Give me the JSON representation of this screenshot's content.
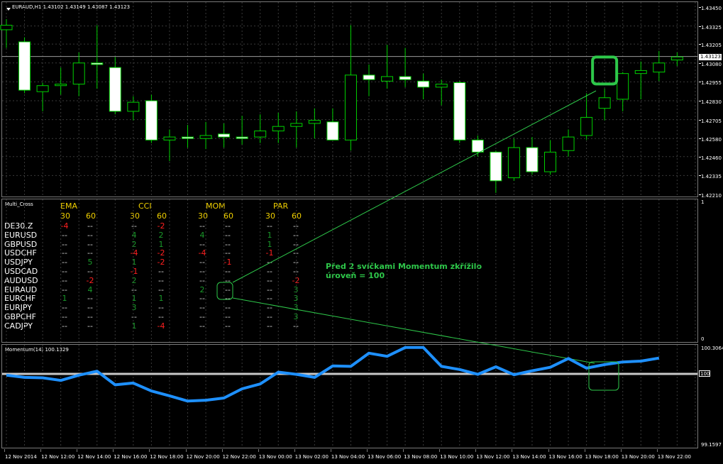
{
  "chart_data": [
    {
      "type": "candlestick",
      "title": "EURAUD,H1  1.43102 1.43149 1.43087 1.43123",
      "symbol": "EURAUD",
      "timeframe": "H1",
      "ohlc_header": "1.43102 1.43149 1.43087 1.43123",
      "current_price": "1.43123",
      "y_ticks": [
        "1.43450",
        "1.43325",
        "1.43205",
        "1.43080",
        "1.42955",
        "1.42830",
        "1.42705",
        "1.42580",
        "1.42460",
        "1.42335",
        "1.42210"
      ],
      "ylim": [
        1.4221,
        1.4345
      ],
      "candles": [
        {
          "o": 1.433,
          "h": 1.4337,
          "l": 1.4318,
          "c": 1.4333
        },
        {
          "o": 1.4322,
          "h": 1.4325,
          "l": 1.4288,
          "c": 1.429
        },
        {
          "o": 1.4289,
          "h": 1.4295,
          "l": 1.4276,
          "c": 1.4293
        },
        {
          "o": 1.4293,
          "h": 1.4305,
          "l": 1.4287,
          "c": 1.4294
        },
        {
          "o": 1.4294,
          "h": 1.4315,
          "l": 1.4286,
          "c": 1.4308
        },
        {
          "o": 1.4308,
          "h": 1.4333,
          "l": 1.4291,
          "c": 1.4307
        },
        {
          "o": 1.4305,
          "h": 1.4312,
          "l": 1.4274,
          "c": 1.4276
        },
        {
          "o": 1.4276,
          "h": 1.4286,
          "l": 1.427,
          "c": 1.4282
        },
        {
          "o": 1.4283,
          "h": 1.4287,
          "l": 1.4255,
          "c": 1.4257
        },
        {
          "o": 1.4257,
          "h": 1.4264,
          "l": 1.4243,
          "c": 1.4259
        },
        {
          "o": 1.4259,
          "h": 1.4267,
          "l": 1.4252,
          "c": 1.4258
        },
        {
          "o": 1.4258,
          "h": 1.4269,
          "l": 1.4251,
          "c": 1.426
        },
        {
          "o": 1.4261,
          "h": 1.4268,
          "l": 1.4252,
          "c": 1.4259
        },
        {
          "o": 1.4259,
          "h": 1.4273,
          "l": 1.4254,
          "c": 1.4258
        },
        {
          "o": 1.4259,
          "h": 1.4274,
          "l": 1.4255,
          "c": 1.4263
        },
        {
          "o": 1.4263,
          "h": 1.4275,
          "l": 1.4255,
          "c": 1.4266
        },
        {
          "o": 1.4266,
          "h": 1.4276,
          "l": 1.4252,
          "c": 1.4268
        },
        {
          "o": 1.4268,
          "h": 1.4278,
          "l": 1.4258,
          "c": 1.427
        },
        {
          "o": 1.4269,
          "h": 1.4278,
          "l": 1.4259,
          "c": 1.4257
        },
        {
          "o": 1.4257,
          "h": 1.4333,
          "l": 1.425,
          "c": 1.43
        },
        {
          "o": 1.43,
          "h": 1.4307,
          "l": 1.4286,
          "c": 1.4297
        },
        {
          "o": 1.4296,
          "h": 1.432,
          "l": 1.4291,
          "c": 1.4299
        },
        {
          "o": 1.4299,
          "h": 1.4318,
          "l": 1.4292,
          "c": 1.4297
        },
        {
          "o": 1.4296,
          "h": 1.4301,
          "l": 1.4284,
          "c": 1.4292
        },
        {
          "o": 1.4292,
          "h": 1.4297,
          "l": 1.428,
          "c": 1.4294
        },
        {
          "o": 1.4295,
          "h": 1.4296,
          "l": 1.4255,
          "c": 1.4257
        },
        {
          "o": 1.4257,
          "h": 1.426,
          "l": 1.4246,
          "c": 1.4249
        },
        {
          "o": 1.4249,
          "h": 1.425,
          "l": 1.4222,
          "c": 1.423
        },
        {
          "o": 1.4232,
          "h": 1.4258,
          "l": 1.423,
          "c": 1.4252
        },
        {
          "o": 1.4252,
          "h": 1.4259,
          "l": 1.4234,
          "c": 1.4236
        },
        {
          "o": 1.4236,
          "h": 1.4257,
          "l": 1.4234,
          "c": 1.4249
        },
        {
          "o": 1.425,
          "h": 1.4264,
          "l": 1.4246,
          "c": 1.4259
        },
        {
          "o": 1.426,
          "h": 1.4288,
          "l": 1.4257,
          "c": 1.4272
        },
        {
          "o": 1.4278,
          "h": 1.4291,
          "l": 1.427,
          "c": 1.4285
        },
        {
          "o": 1.4284,
          "h": 1.4302,
          "l": 1.4276,
          "c": 1.4301
        },
        {
          "o": 1.4301,
          "h": 1.4309,
          "l": 1.4284,
          "c": 1.4303
        },
        {
          "o": 1.4302,
          "h": 1.4316,
          "l": 1.4296,
          "c": 1.4308
        },
        {
          "o": 1.431,
          "h": 1.4315,
          "l": 1.4306,
          "c": 1.4312
        }
      ]
    },
    {
      "type": "line",
      "title": "Momentum(14) 100.1329",
      "series": [
        {
          "name": "Momentum(14)",
          "values": [
            99.985,
            99.96,
            99.955,
            99.925,
            99.985,
            100.03,
            99.875,
            99.895,
            99.805,
            99.75,
            99.69,
            99.7,
            99.725,
            99.83,
            99.885,
            100.02,
            99.995,
            99.96,
            100.09,
            100.085,
            100.235,
            100.2,
            100.3,
            100.3,
            100.085,
            100.05,
            99.995,
            100.08,
            99.99,
            100.035,
            100.075,
            100.175,
            100.065,
            100.105,
            100.135,
            100.145,
            100.18
          ]
        }
      ],
      "y_ticks_top": "100.3064",
      "y_ticks_bottom": "99.1597",
      "level": "100",
      "ylim": [
        99.1597,
        100.3064
      ]
    }
  ],
  "x_labels": [
    "12 Nov 2014",
    "12 Nov 12:00",
    "12 Nov 14:00",
    "12 Nov 16:00",
    "12 Nov 18:00",
    "12 Nov 20:00",
    "12 Nov 22:00",
    "13 Nov 00:00",
    "13 Nov 02:00",
    "13 Nov 04:00",
    "13 Nov 06:00",
    "13 Nov 08:00",
    "13 Nov 10:00",
    "13 Nov 12:00",
    "13 Nov 14:00",
    "13 Nov 16:00",
    "13 Nov 18:00",
    "13 Nov 20:00",
    "13 Nov 22:00"
  ],
  "multi_cross": {
    "title": "Multi_Cross",
    "scale_top": "1",
    "scale_bottom": "0",
    "groups": [
      "EMA",
      "CCI",
      "MOM",
      "PAR"
    ],
    "periods": [
      "30",
      "60"
    ],
    "symbols": [
      "DE30.Z",
      "EURUSD",
      "GBPUSD",
      "USDCHF",
      "USDJPY",
      "USDCAD",
      "AUDUSD",
      "EURAUD",
      "EURCHF",
      "EURJPY",
      "GBPCHF",
      "CADJPY"
    ],
    "rows": [
      [
        [
          "-4",
          "red"
        ],
        [
          "--",
          "dash"
        ],
        [
          "--",
          "dash"
        ],
        [
          "-2",
          "red"
        ],
        [
          "--",
          "dash"
        ],
        [
          "--",
          "dash"
        ],
        [
          "--",
          "dash"
        ],
        [
          "--",
          "dash"
        ]
      ],
      [
        [
          "--",
          "dash"
        ],
        [
          "--",
          "dash"
        ],
        [
          "4",
          "green"
        ],
        [
          "2",
          "green"
        ],
        [
          "4",
          "green"
        ],
        [
          "--",
          "dash"
        ],
        [
          "1",
          "green"
        ],
        [
          "--",
          "dash"
        ]
      ],
      [
        [
          "--",
          "dash"
        ],
        [
          "--",
          "dash"
        ],
        [
          "2",
          "green"
        ],
        [
          "1",
          "green"
        ],
        [
          "--",
          "dash"
        ],
        [
          "--",
          "dash"
        ],
        [
          "1",
          "green"
        ],
        [
          "--",
          "dash"
        ]
      ],
      [
        [
          "--",
          "dash"
        ],
        [
          "--",
          "dash"
        ],
        [
          "-4",
          "red"
        ],
        [
          "-2",
          "red"
        ],
        [
          "-4",
          "red"
        ],
        [
          "--",
          "dash"
        ],
        [
          "-1",
          "red"
        ],
        [
          "--",
          "dash"
        ]
      ],
      [
        [
          "--",
          "dash"
        ],
        [
          "5",
          "green"
        ],
        [
          "1",
          "green"
        ],
        [
          "-2",
          "red"
        ],
        [
          "--",
          "dash"
        ],
        [
          "-1",
          "red"
        ],
        [
          "--",
          "dash"
        ],
        [
          "--",
          "dash"
        ]
      ],
      [
        [
          "--",
          "dash"
        ],
        [
          "--",
          "dash"
        ],
        [
          "-1",
          "red"
        ],
        [
          "--",
          "dash"
        ],
        [
          "--",
          "dash"
        ],
        [
          "--",
          "dash"
        ],
        [
          "--",
          "dash"
        ],
        [
          "--",
          "dash"
        ]
      ],
      [
        [
          "--",
          "dash"
        ],
        [
          "-2",
          "red"
        ],
        [
          "2",
          "green"
        ],
        [
          "--",
          "dash"
        ],
        [
          "--",
          "dash"
        ],
        [
          "--",
          "dash"
        ],
        [
          "--",
          "dash"
        ],
        [
          "-2",
          "red"
        ]
      ],
      [
        [
          "--",
          "dash"
        ],
        [
          "4",
          "green"
        ],
        [
          "--",
          "dash"
        ],
        [
          "--",
          "dash"
        ],
        [
          "2",
          "green"
        ],
        [
          "--",
          "dash"
        ],
        [
          "--",
          "dash"
        ],
        [
          "3",
          "green"
        ]
      ],
      [
        [
          "1",
          "green"
        ],
        [
          "--",
          "dash"
        ],
        [
          "1",
          "green"
        ],
        [
          "1",
          "green"
        ],
        [
          "--",
          "dash"
        ],
        [
          "--",
          "dash"
        ],
        [
          "--",
          "dash"
        ],
        [
          "3",
          "green"
        ]
      ],
      [
        [
          "--",
          "dash"
        ],
        [
          "--",
          "dash"
        ],
        [
          "3",
          "green"
        ],
        [
          "--",
          "dash"
        ],
        [
          "--",
          "dash"
        ],
        [
          "--",
          "dash"
        ],
        [
          "--",
          "dash"
        ],
        [
          "3",
          "green"
        ]
      ],
      [
        [
          "--",
          "dash"
        ],
        [
          "--",
          "dash"
        ],
        [
          "--",
          "dash"
        ],
        [
          "--",
          "dash"
        ],
        [
          "--",
          "dash"
        ],
        [
          "--",
          "dash"
        ],
        [
          "--",
          "dash"
        ],
        [
          "3",
          "green"
        ]
      ],
      [
        [
          "--",
          "dash"
        ],
        [
          "--",
          "dash"
        ],
        [
          "1",
          "green"
        ],
        [
          "-4",
          "red"
        ],
        [
          "--",
          "dash"
        ],
        [
          "--",
          "dash"
        ],
        [
          "--",
          "dash"
        ],
        [
          "--",
          "dash"
        ]
      ]
    ]
  },
  "annotation": {
    "line1": "Před 2 svíčkami Momentum zkřížilo",
    "line2": "úroveň = 100"
  },
  "colors": {
    "bull": "#000000",
    "bear": "#ffffff",
    "candle_outline": "#00d000",
    "momentum": "#1e90ff",
    "highlight": "#2ec84a",
    "level": "#c8c8c8"
  }
}
